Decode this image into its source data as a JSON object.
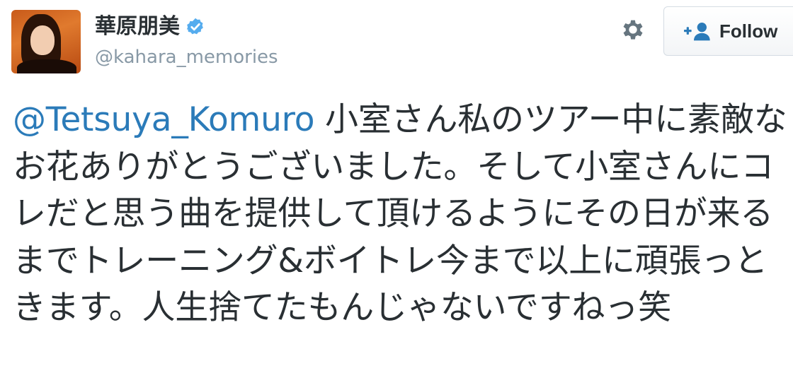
{
  "user": {
    "display_name": "華原朋美",
    "handle": "@kahara_memories",
    "verified": true,
    "avatar_icon": "profile-photo"
  },
  "actions": {
    "settings_icon": "gear-icon",
    "follow_icon": "add-user-icon",
    "follow_label": "Follow"
  },
  "tweet": {
    "mention": "@Tetsuya_Komuro",
    "text": " 小室さん私のツアー中に素敵なお花ありがとうございました。そして小室さんにコレだと思う曲を提供して頂けるようにその日が来るまでトレーニング&ボイトレ今まで以上に頑張っときます。人生捨てたもんじゃないですねっ笑"
  },
  "colors": {
    "text": "#292f33",
    "secondary": "#8899a6",
    "link": "#2b7bb9",
    "verified_badge": "#55acee"
  }
}
